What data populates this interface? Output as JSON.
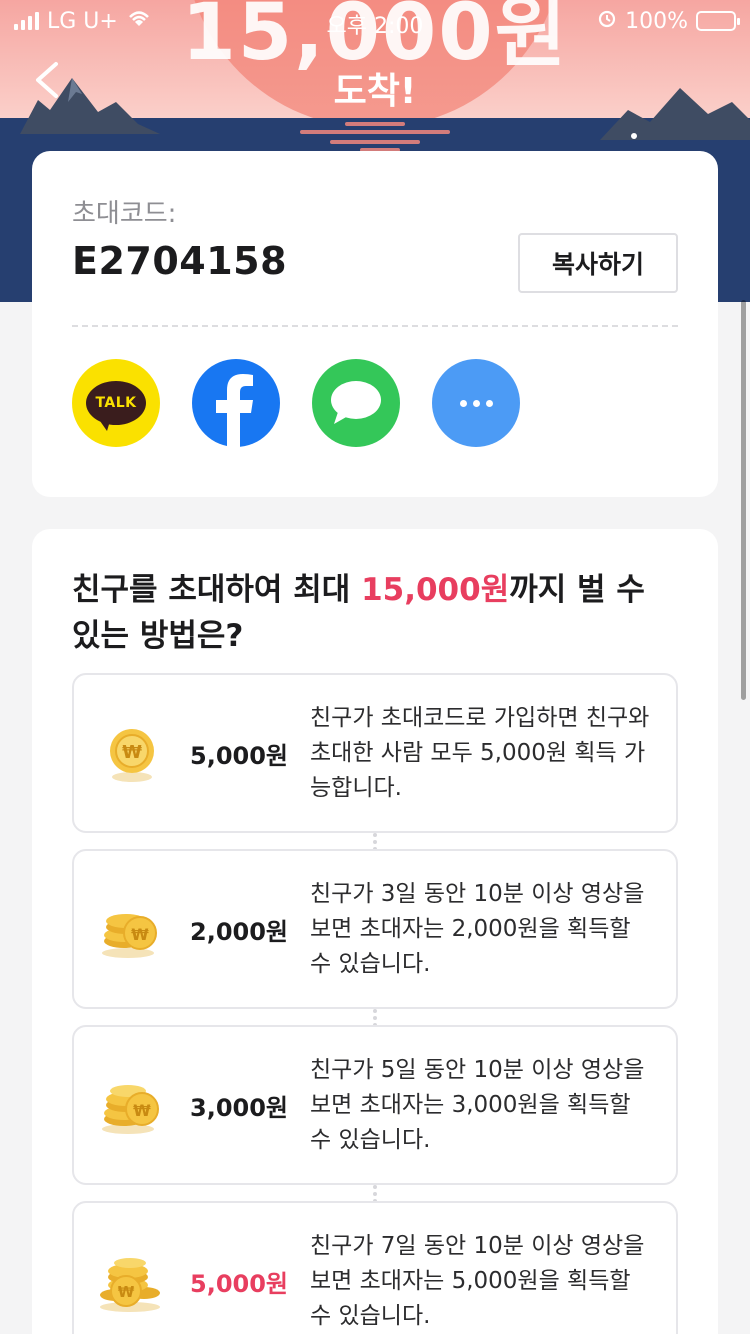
{
  "status_bar": {
    "carrier": "LG U+",
    "time": "오후 2:00",
    "battery": "100%"
  },
  "hero": {
    "amount": "15,000원",
    "subtitle": "도착!"
  },
  "invite": {
    "code_label": "초대코드:",
    "code_value": "E2704158",
    "copy_label": "복사하기",
    "share": [
      {
        "name": "kakaotalk",
        "label": "TALK",
        "color": "#fae100"
      },
      {
        "name": "facebook",
        "color": "#1877f2"
      },
      {
        "name": "message",
        "color": "#34c759"
      },
      {
        "name": "more",
        "color": "#4c9bf5"
      }
    ]
  },
  "howto": {
    "title_before": "친구를 초대하여 최대 ",
    "title_accent": "15,000원",
    "title_after": "까지 벌 수 있는 방법은?",
    "steps": [
      {
        "amount": "5,000원",
        "desc": "친구가 초대코드로 가입하면 친구와 초대한 사람 모두 5,000원 획득 가능합니다.",
        "icon": "single-coin-icon"
      },
      {
        "amount": "2,000원",
        "desc": "친구가 3일 동안 10분 이상 영상을 보면 초대자는 2,000원을 획득할 수 있습니다.",
        "icon": "coin-stack-icon"
      },
      {
        "amount": "3,000원",
        "desc": "친구가 5일 동안 10분 이상 영상을 보면 초대자는 3,000원을 획득할 수 있습니다.",
        "icon": "coin-stack-icon"
      },
      {
        "amount": "5,000원",
        "desc": "친구가 7일 동안 10분 이상 영상을 보면 초대자는 5,000원을 획득할 수 있습니다.",
        "icon": "coin-pile-icon"
      }
    ]
  },
  "colors": {
    "accent": "#e83e5f",
    "hero_sky": "#f6a6a1",
    "hero_sea": "#263f70"
  }
}
